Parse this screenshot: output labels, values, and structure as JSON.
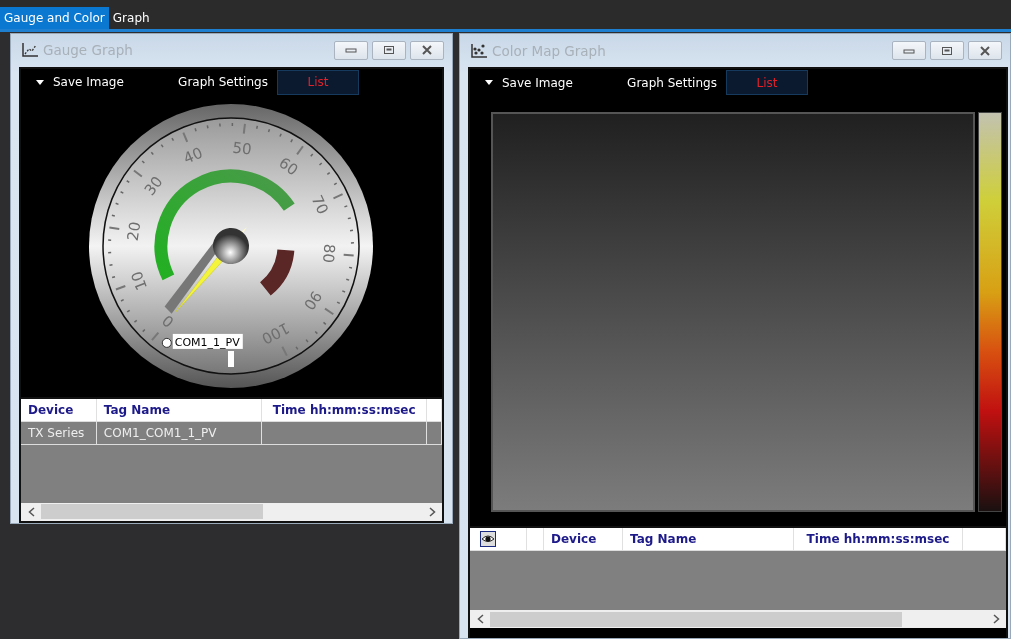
{
  "tabs": [
    {
      "label": "Gauge and Color",
      "selected": true
    },
    {
      "label": "Graph",
      "selected": false
    }
  ],
  "windows": [
    {
      "kind": "gauge",
      "title": "Gauge Graph",
      "toolbar": [
        {
          "label": "Save Image",
          "kind": "menu",
          "selected": false
        },
        {
          "label": "Graph Settings",
          "kind": "button",
          "selected": false
        },
        {
          "label": "List",
          "kind": "button",
          "selected": true
        }
      ],
      "gauge": {
        "scale": [
          "0",
          "10",
          "20",
          "30",
          "40",
          "50",
          "60",
          "70",
          "80",
          "90",
          "100"
        ],
        "tag": "COM1_1_PV"
      },
      "table": {
        "columns": [
          {
            "label": "Device",
            "kind": "text"
          },
          {
            "label": "Tag Name",
            "kind": "text"
          },
          {
            "label": "Time hh:mm:ss:msec",
            "kind": "text"
          },
          {
            "kind": "filler"
          }
        ],
        "rows": [
          [
            "TX Series",
            "COM1_COM1_1_PV",
            "",
            ""
          ]
        ]
      }
    },
    {
      "kind": "colormap",
      "title": "Color Map Graph",
      "toolbar": [
        {
          "label": "Save Image",
          "kind": "menu",
          "selected": false
        },
        {
          "label": "Graph Settings",
          "kind": "button",
          "selected": false
        },
        {
          "label": "List",
          "kind": "button",
          "selected": true
        }
      ],
      "table": {
        "columns": [
          {
            "kind": "eye"
          },
          {
            "kind": "filler"
          },
          {
            "label": "Device",
            "kind": "text"
          },
          {
            "label": "Tag Name",
            "kind": "text"
          },
          {
            "label": "Time hh:mm:ss:msec",
            "kind": "text"
          },
          {
            "kind": "filler"
          }
        ]
      }
    }
  ]
}
